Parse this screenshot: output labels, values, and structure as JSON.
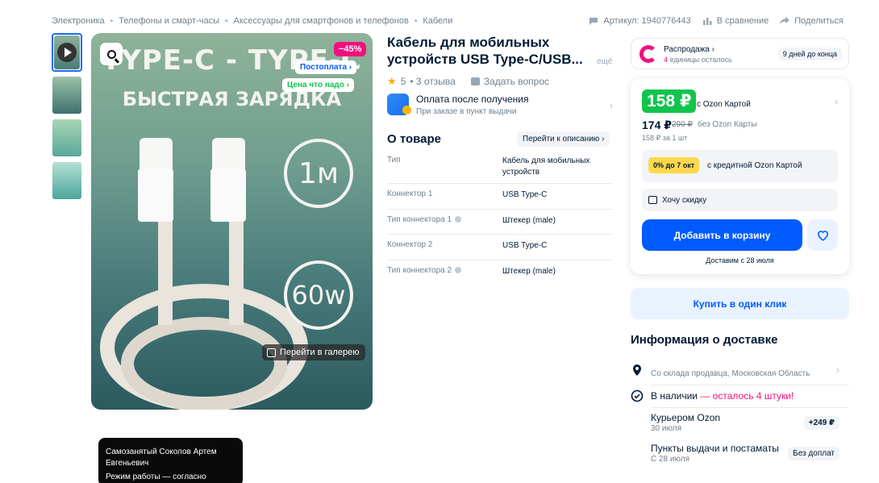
{
  "breadcrumbs": [
    "Электроника",
    "Телефоны и смарт-часы",
    "Аксессуары для смартфонов и телефонов",
    "Кабели"
  ],
  "top_actions": {
    "article": "Артикул: 1940776443",
    "compare": "В сравнение",
    "share": "Поделиться"
  },
  "gallery": {
    "hero_title": "TYPE-C - TYPE-C",
    "hero_subtitle": "БЫСТРАЯ ЗАРЯДКА",
    "length": "1м",
    "power": "60w",
    "discount": "−45%",
    "postpay_badge": "Постоплата ›",
    "price_badge": "Цена что надо ›",
    "gallery_button": "Перейти в галерею"
  },
  "seller_popup": {
    "line1": "Самозанятый Соколов Артем Евгеньевич",
    "line2": "Режим работы — согласно"
  },
  "product": {
    "title": "Кабель для мобильных устройств USB Type-C/USB...",
    "more": "ещё",
    "rating": "5",
    "reviews": "• 3 отзыва",
    "ask": "Задать вопрос",
    "postpay_title": "Оплата после получения",
    "postpay_sub": "При заказе в пункт выдачи"
  },
  "about": {
    "heading": "О товаре",
    "link": "Перейти к описанию ›",
    "specs": [
      {
        "k": "Тип",
        "v": "Кабель для мобильных устройств",
        "info": false
      },
      {
        "k": "Коннектор 1",
        "v": "USB Type-C",
        "info": false
      },
      {
        "k": "Тип коннектора 1",
        "v": "Штекер (male)",
        "info": true
      },
      {
        "k": "Коннектор 2",
        "v": "USB Type-C",
        "info": false
      },
      {
        "k": "Тип коннектора 2",
        "v": "Штекер (male)",
        "info": true
      }
    ]
  },
  "sale": {
    "name": "Распродажа ›",
    "left_count": "4",
    "left_text": " единицы осталось",
    "days": "9 дней до конца"
  },
  "price": {
    "card_price": "158 ₽",
    "card_label": "с Ozon Картой",
    "regular": "174 ₽",
    "old": "290 ₽",
    "no_card": "без Ozon Карты",
    "unit": "158 ₽ за 1 шт",
    "credit_tag": "0% до 7 окт",
    "credit_text": "с кредитной Ozon Картой",
    "want_discount": "Хочу скидку",
    "add_to_cart": "Добавить в корзину",
    "delivery_date": "Доставим с 28 июля",
    "one_click": "Купить в один клик"
  },
  "delivery": {
    "heading": "Информация о доставке",
    "warehouse": "Со склада продавца, Московская Область",
    "stock_main": "В наличии",
    "stock_pink": " — осталось 4 штуки!",
    "courier_title": "Курьером Ozon",
    "courier_date": "30 июля",
    "courier_price": "+249 ₽",
    "pickup_title": "Пункты выдачи и постаматы",
    "pickup_date": "С 28 июля",
    "pickup_price": "Без доплат"
  },
  "colors": {
    "accent": "#005bff",
    "green": "#10c44c",
    "pink": "#f1117e"
  }
}
